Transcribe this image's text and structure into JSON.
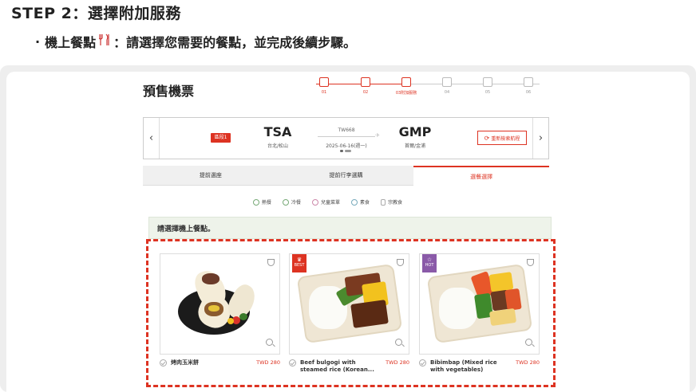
{
  "header": {
    "step_title": "STEP 2：選擇附加服務",
    "bullet": "·",
    "desc_prefix": "機上餐點",
    "desc_icon": "utensils-icon",
    "desc_suffix": "：請選擇您需要的餐點，並完成後續步驟。"
  },
  "page": {
    "title": "預售機票"
  },
  "stepper": {
    "steps": [
      {
        "num": "01",
        "icon": "calendar-icon",
        "active": true
      },
      {
        "num": "02",
        "icon": "edit-icon",
        "active": true
      },
      {
        "num": "03附加服務",
        "icon": "gift-icon",
        "active": true
      },
      {
        "num": "04",
        "icon": "document-icon",
        "active": false
      },
      {
        "num": "05",
        "icon": "shield-icon",
        "active": false
      },
      {
        "num": "06",
        "icon": "card-icon",
        "active": false
      }
    ]
  },
  "flight": {
    "segment": "區段1",
    "origin_code": "TSA",
    "origin_city": "台北/松山",
    "flight_no": "TW668",
    "date": "2025-06-16(週一)",
    "dest_code": "GMP",
    "dest_city": "首爾/金浦",
    "research_label": "重新檢索航程",
    "prev_arrow": "‹",
    "next_arrow": "›"
  },
  "tabs": [
    {
      "label": "提前選座",
      "active": false
    },
    {
      "label": "提前行李選購",
      "active": false
    },
    {
      "label": "選餐選擇",
      "active": true
    }
  ],
  "categories": [
    {
      "label": "熱餐",
      "icon": "hot-meal-icon"
    },
    {
      "label": "冷餐",
      "icon": "cold-meal-icon"
    },
    {
      "label": "兒童菜單",
      "icon": "kids-meal-icon"
    },
    {
      "label": "素食",
      "icon": "vegetarian-icon"
    },
    {
      "label": "宗教食",
      "icon": "religious-meal-icon"
    }
  ],
  "prompt": "請選擇機上餐點。",
  "meals": [
    {
      "name": "烤肉玉米餅",
      "price": "TWD 280",
      "tag": ""
    },
    {
      "name": "Beef bulgogi with steamed rice (Korean...",
      "price": "TWD 280",
      "tag": "BEST"
    },
    {
      "name": "Bibimbap (Mixed rice with vegetables)",
      "price": "TWD 280",
      "tag": "HOT"
    }
  ],
  "colors": {
    "accent": "#dd3322",
    "hot_tag": "#8a5aa8",
    "prompt_bg": "#eef3ea"
  }
}
